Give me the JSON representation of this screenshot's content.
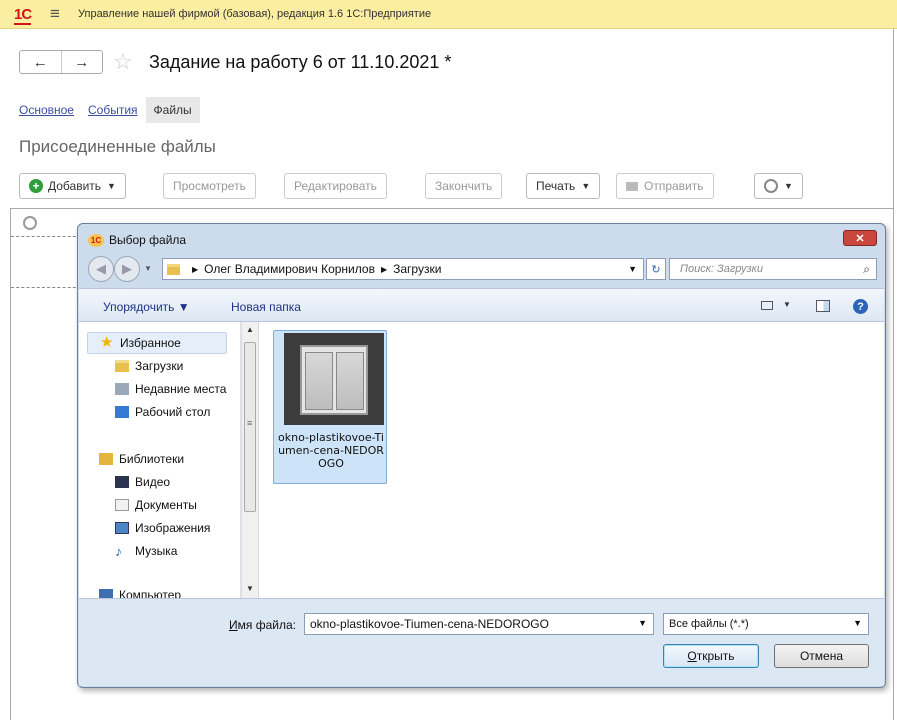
{
  "app": {
    "title": "Управление нашей фирмой (базовая), редакция 1.6 1С:Предприятие",
    "logo": "1С"
  },
  "document": {
    "title": "Задание на работу 6 от 11.10.2021 *",
    "tabs": [
      {
        "label": "Основное"
      },
      {
        "label": "События"
      },
      {
        "label": "Файлы"
      }
    ],
    "section_title": "Присоединенные файлы",
    "toolbar": {
      "add": "Добавить",
      "view": "Просмотреть",
      "edit": "Редактировать",
      "finish": "Закончить",
      "print": "Печать",
      "send": "Отправить"
    }
  },
  "dialog": {
    "title": "Выбор файла",
    "breadcrumb": [
      "Олег Владимирович Корнилов",
      "Загрузки"
    ],
    "search_placeholder": "Поиск: Загрузки",
    "commands": {
      "organize": "Упорядочить ▼",
      "new_folder": "Новая папка"
    },
    "nav": {
      "favorites": "Избранное",
      "downloads": "Загрузки",
      "recent": "Недавние места",
      "desktop": "Рабочий стол",
      "libraries": "Библиотеки",
      "video": "Видео",
      "documents": "Документы",
      "images": "Изображения",
      "music": "Музыка",
      "computer": "Компьютер"
    },
    "file": {
      "name": "okno-plastikovoe-Tiumen-cena-NEDOROGO"
    },
    "filename_label_underlined": "И",
    "filename_label_rest": "мя файла:",
    "filename_value": "okno-plastikovoe-Tiumen-cena-NEDOROGO",
    "filetype": "Все файлы (*.*)",
    "open_underlined": "О",
    "open_rest": "ткрыть",
    "cancel": "Отмена"
  },
  "colors": {
    "titlebar": "#fbeda1",
    "brand_red": "#d4131a",
    "link": "#3a4d9f",
    "add_icon": "#2c9e3b"
  }
}
